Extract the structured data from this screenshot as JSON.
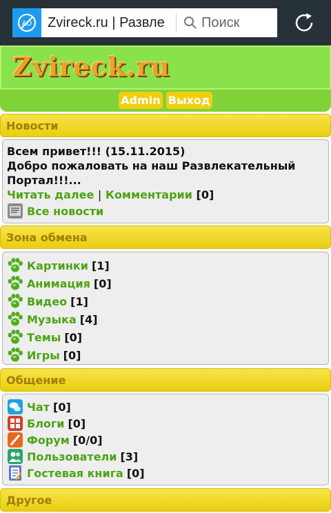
{
  "browser": {
    "url": "Zvireck.ru | Развле",
    "search_label": "Поиск"
  },
  "site": {
    "logo": "Zvireck.ru",
    "admin_label": "Admin",
    "logout_label": "Выход"
  },
  "news": {
    "title": "Новости",
    "greeting": "Всем привет!!! (15.11.2015)",
    "welcome": "Добро пожаловать на наш Развлекательный Портал!!!...",
    "read_more": "Читать далее",
    "separator": "|",
    "comments": "Комментарии",
    "comments_count": "[0]",
    "all_news": "Все новости"
  },
  "exchange": {
    "title": "Зона обмена",
    "items": [
      {
        "label": "Картинки",
        "count": "[1]"
      },
      {
        "label": "Анимация",
        "count": "[0]"
      },
      {
        "label": "Видео",
        "count": "[1]"
      },
      {
        "label": "Музыка",
        "count": "[4]"
      },
      {
        "label": "Темы",
        "count": "[0]"
      },
      {
        "label": "Игры",
        "count": "[0]"
      }
    ]
  },
  "social": {
    "title": "Общение",
    "items": [
      {
        "label": "Чат",
        "count": "[0]",
        "icon": "chat-icon"
      },
      {
        "label": "Блоги",
        "count": "[0]",
        "icon": "blog-icon"
      },
      {
        "label": "Форум",
        "count": "[0/0]",
        "icon": "forum-icon"
      },
      {
        "label": "Пользователи",
        "count": "[3]",
        "icon": "users-icon"
      },
      {
        "label": "Гостевая книга",
        "count": "[0]",
        "icon": "guestbook-icon"
      }
    ]
  },
  "other": {
    "title": "Другое"
  },
  "colors": {
    "link": "#4ca414",
    "section_header": "#f1d615",
    "header_green": "#89e24c",
    "toolbar": "#263238"
  }
}
